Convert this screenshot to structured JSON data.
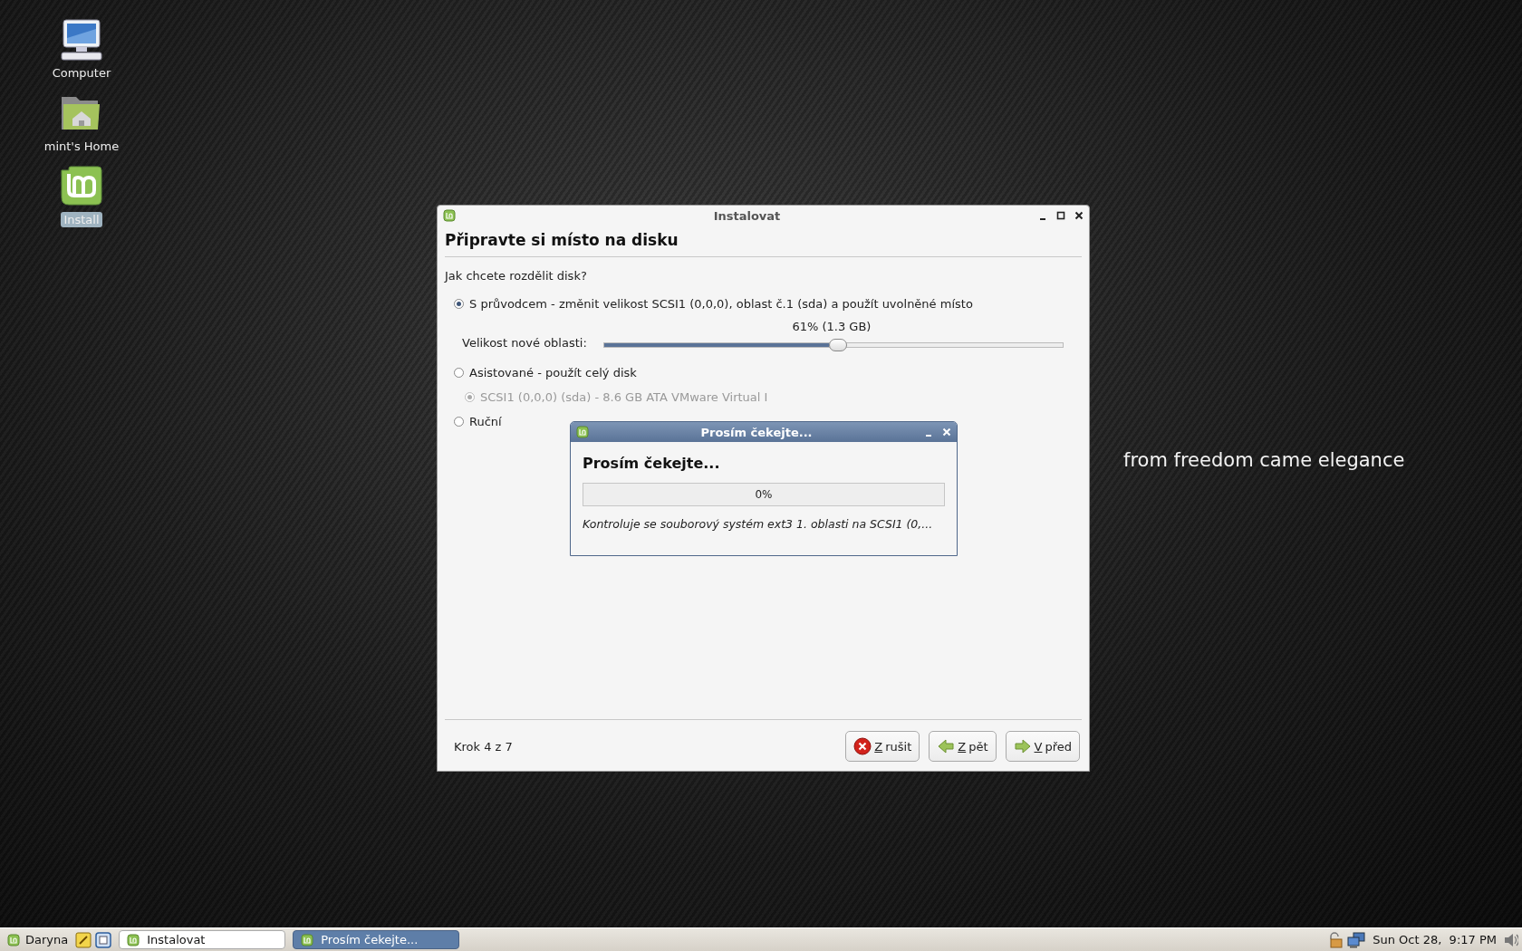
{
  "desktop_icons": [
    {
      "kind": "computer",
      "label": "Computer",
      "selected": false
    },
    {
      "kind": "home",
      "label": "mint's Home",
      "selected": false
    },
    {
      "kind": "mint",
      "label": "Install",
      "selected": true
    }
  ],
  "wallpaper": {
    "slogan": "from freedom came elegance"
  },
  "installer": {
    "title": "Instalovat",
    "heading": "Připravte si místo na disku",
    "question": "Jak chcete rozdělit disk?",
    "options": [
      {
        "kind": "radio",
        "label": "S průvodcem - změnit velikost SCSI1 (0,0,0), oblast č.1 (sda) a použít uvolněné místo",
        "selected": true,
        "disabled": false
      },
      {
        "kind": "slider",
        "label": "Velikost nové oblasti:",
        "reading": "61% (1.3 GB)",
        "level": 0.49
      },
      {
        "kind": "radio",
        "label": "Asistované - použít celý disk",
        "selected": false,
        "disabled": false
      },
      {
        "kind": "subradio",
        "label": "SCSI1 (0,0,0) (sda) - 8.6 GB ATA VMware Virtual I",
        "selected": true,
        "disabled": true
      },
      {
        "kind": "radio",
        "label": "Ruční",
        "selected": false,
        "disabled": false
      }
    ],
    "step": "Krok 4 z 7",
    "buttons": [
      {
        "kind": "cancel",
        "accel": "Z",
        "rest": "rušit"
      },
      {
        "kind": "back",
        "accel": "Z",
        "rest": "pět"
      },
      {
        "kind": "forward",
        "accel": "V",
        "rest": "před"
      }
    ]
  },
  "dialog": {
    "title": "Prosím čekejte...",
    "heading": "Prosím čekejte...",
    "progress": {
      "level": 0,
      "reading": "0%"
    },
    "message": "Kontroluje se souborový systém ext3 1. oblasti na SCSI1 (0,..."
  },
  "taskbar": {
    "menu": "Daryna",
    "windows": [
      {
        "label": "Instalovat",
        "selected": false
      },
      {
        "label": "Prosím čekejte...",
        "selected": true
      }
    ],
    "clock": "Sun Oct 28,  9:17 PM"
  }
}
